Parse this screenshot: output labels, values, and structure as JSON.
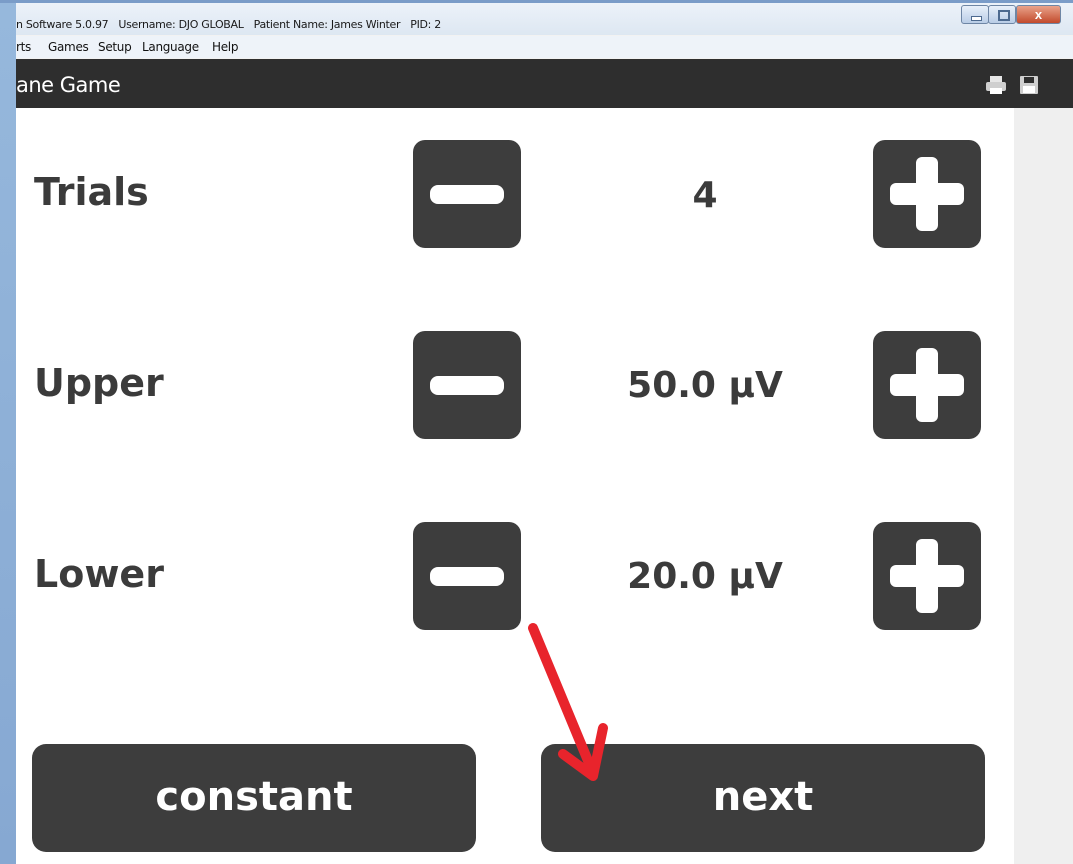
{
  "window": {
    "title_segments": [
      "n Software 5.0.97",
      "Username: DJO GLOBAL",
      "Patient Name: James Winter",
      "PID: 2"
    ],
    "close_glyph": "x"
  },
  "menu": [
    "rts",
    "Games",
    "Setup",
    "Language",
    "Help"
  ],
  "header": {
    "title": "ane Game",
    "icons": [
      "printer-icon",
      "save-icon"
    ]
  },
  "settings": [
    {
      "label": "Trials",
      "value": "4"
    },
    {
      "label": "Upper",
      "value": "50.0 µV"
    },
    {
      "label": "Lower",
      "value": "20.0 µV"
    }
  ],
  "buttons": {
    "constant": "constant",
    "next": "next"
  },
  "colors": {
    "button_dark": "#3d3d3d",
    "header_dark": "#2e2e2e",
    "annotation_arrow": "#e8242c"
  }
}
